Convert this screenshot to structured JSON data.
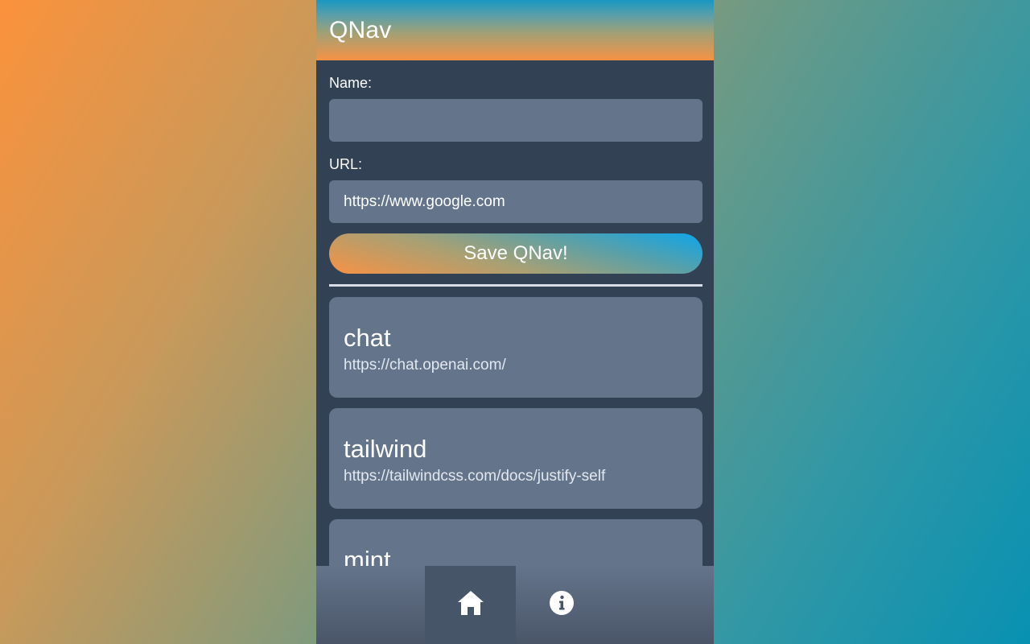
{
  "header": {
    "title": "QNav"
  },
  "form": {
    "name_label": "Name:",
    "name_value": "",
    "url_label": "URL:",
    "url_value": "https://www.google.com",
    "save_label": "Save QNav!"
  },
  "bookmarks": [
    {
      "name": "chat",
      "url": "https://chat.openai.com/"
    },
    {
      "name": "tailwind",
      "url": "https://tailwindcss.com/docs/justify-self"
    },
    {
      "name": "mint",
      "url": ""
    }
  ],
  "nav": {
    "home_icon": "home-icon",
    "info_icon": "info-icon",
    "active": "home"
  },
  "colors": {
    "panel": "#334155",
    "field": "#64748b",
    "accent_orange": "#fb923c",
    "accent_cyan": "#0891b2"
  }
}
